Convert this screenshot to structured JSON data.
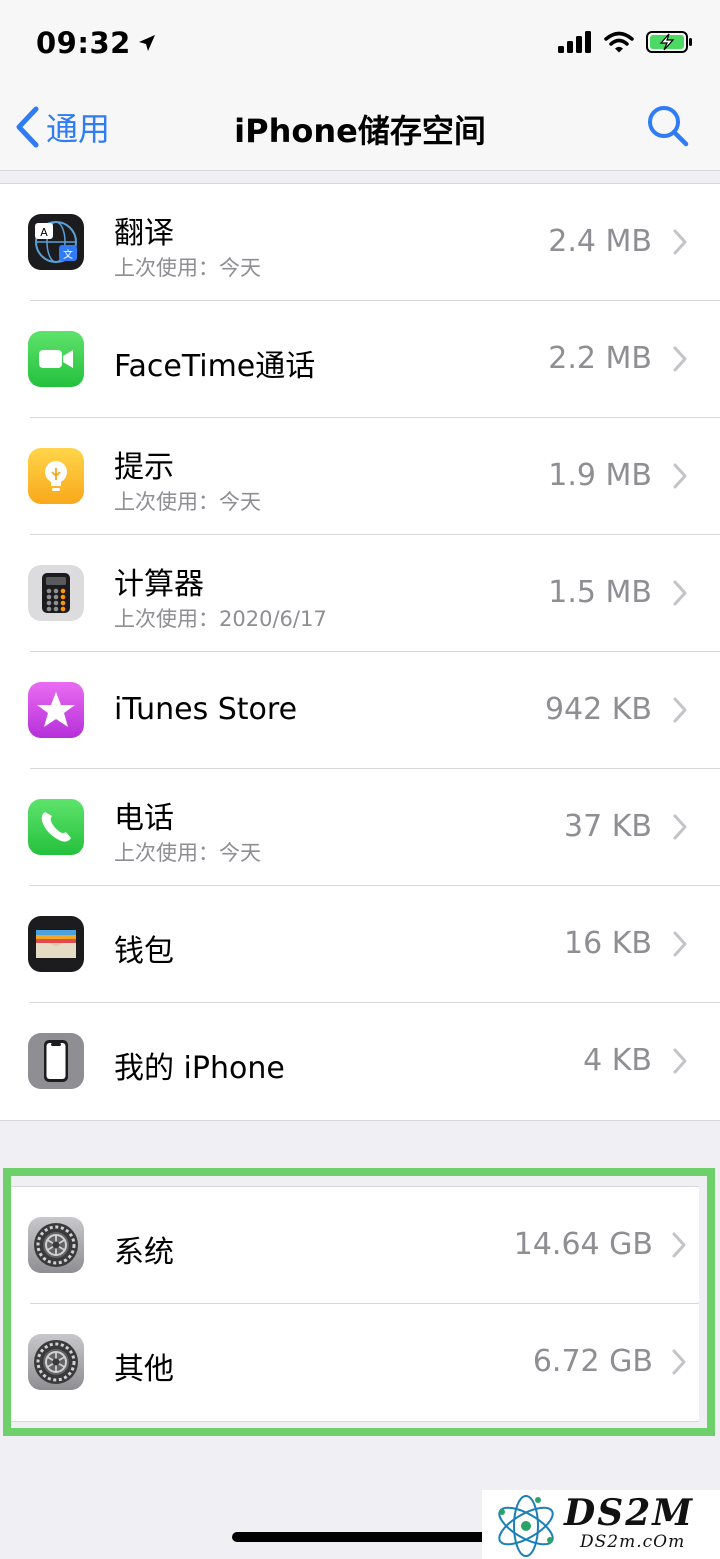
{
  "status": {
    "time": "09:32"
  },
  "nav": {
    "back_label": "通用",
    "title": "iPhone储存空间"
  },
  "apps": [
    {
      "name": "翻译",
      "last_used": "上次使用：今天",
      "size": "2.4 MB"
    },
    {
      "name": "FaceTime通话",
      "size": "2.2 MB"
    },
    {
      "name": "提示",
      "last_used": "上次使用：今天",
      "size": "1.9 MB"
    },
    {
      "name": "计算器",
      "last_used": "上次使用：2020/6/17",
      "size": "1.5 MB"
    },
    {
      "name": "iTunes Store",
      "size": "942 KB"
    },
    {
      "name": "电话",
      "last_used": "上次使用：今天",
      "size": "37 KB"
    },
    {
      "name": "钱包",
      "size": "16 KB"
    },
    {
      "name": "我的 iPhone",
      "size": "4 KB"
    }
  ],
  "system": [
    {
      "name": "系统",
      "size": "14.64 GB"
    },
    {
      "name": "其他",
      "size": "6.72 GB"
    }
  ],
  "watermark": {
    "brand": "DS2M",
    "site": "DS2m.cOm"
  },
  "colors": {
    "accent": "#2f7cf6",
    "highlight": "#6ed06a",
    "secondary_text": "#8e8e93"
  }
}
